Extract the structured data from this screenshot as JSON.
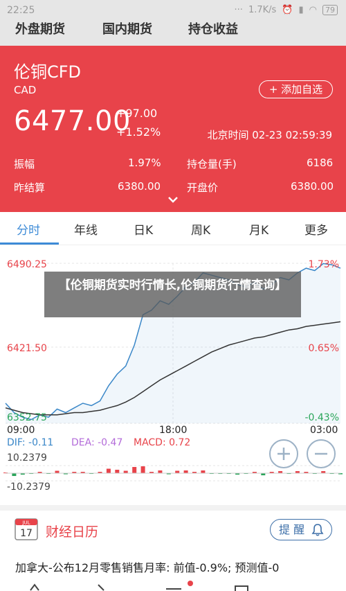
{
  "status_bar": {
    "time": "22:25",
    "net_speed": "1.7K/s",
    "battery": "79"
  },
  "category_tabs": [
    "外盘期货",
    "国内期货",
    "持仓收益"
  ],
  "quote": {
    "name": "伦铜CFD",
    "currency": "CAD",
    "add_label": "+ 添加自选",
    "price": "6477.00",
    "change": "+97.00",
    "change_pct": "+1.52%",
    "time": "北京时间 02-23 02:59:39",
    "stats": [
      {
        "label": "振幅",
        "value": "1.97%"
      },
      {
        "label": "持仓量(手)",
        "value": "6186"
      },
      {
        "label": "昨结算",
        "value": "6380.00"
      },
      {
        "label": "开盘价",
        "value": "6380.00"
      }
    ]
  },
  "period_tabs": [
    "分时",
    "年线",
    "日K",
    "周K",
    "月K",
    "更多"
  ],
  "chart": {
    "y_labels": {
      "top": "6490.25",
      "mid": "6421.50",
      "bottom": "6352.75"
    },
    "pct_labels": {
      "top": "1.73%",
      "mid": "0.65%",
      "bottom": "-0.43%"
    },
    "x_labels": [
      "09:00",
      "18:00",
      "03:00"
    ],
    "macd_header": {
      "dif": "DIF: -0.11",
      "dea": "DEA: -0.47",
      "macd": "MACD: 0.72"
    },
    "macd_labels": {
      "top": "10.2379",
      "bottom": "-10.2379"
    },
    "colors": {
      "price": "#3a87c8",
      "avg": "#333333",
      "dif": "#3a87c8",
      "dea": "#b36bd9",
      "macd_up": "#e8434a",
      "macd_down": "#2aa55a"
    }
  },
  "chart_data": {
    "type": "line",
    "x_ticks": [
      "09:00",
      "18:00",
      "03:00"
    ],
    "ylim": [
      6352.75,
      6490.25
    ],
    "series": [
      {
        "values": [
          6370,
          6362,
          6358,
          6356,
          6360,
          6358,
          6365,
          6362,
          6366,
          6370,
          6368,
          6372,
          6385,
          6395,
          6402,
          6420,
          6446,
          6450,
          6458,
          6455,
          6462,
          6470,
          6474,
          6482,
          6480,
          6478,
          6476,
          6472,
          6470,
          6474,
          6468,
          6472,
          6478,
          6476,
          6482,
          6486,
          6484,
          6490,
          6489,
          6486
        ]
      },
      {
        "values": [
          6366,
          6364,
          6362,
          6361,
          6360,
          6360,
          6360,
          6361,
          6362,
          6362,
          6363,
          6364,
          6366,
          6368,
          6371,
          6375,
          6380,
          6385,
          6390,
          6394,
          6398,
          6402,
          6406,
          6410,
          6414,
          6417,
          6420,
          6422,
          6424,
          6426,
          6427,
          6429,
          6431,
          6433,
          6434,
          6436,
          6437,
          6438,
          6439,
          6440
        ]
      }
    ]
  },
  "overlay_text": "【伦铜期货实时行情长,伦铜期货行情查询】",
  "calendar": {
    "month": "JUL",
    "day": "17",
    "title": "财经日历",
    "remind_label": "提 醒",
    "news": "加拿大-公布12月零售销售月率: 前值-0.9%; 预测值-0"
  }
}
